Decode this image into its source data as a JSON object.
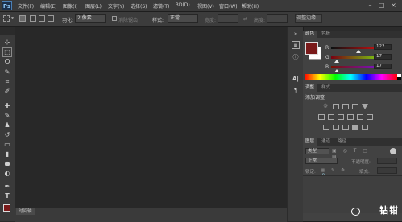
{
  "app": {
    "logo": "Ps"
  },
  "menu": [
    "文件(F)",
    "编辑(E)",
    "图像(I)",
    "图层(L)",
    "文字(Y)",
    "选择(S)",
    "滤镜(T)",
    "3D(D)",
    "视图(V)",
    "窗口(W)",
    "帮助(H)"
  ],
  "window_controls": [
    "–",
    "□",
    "×"
  ],
  "options": {
    "feather_label": "羽化:",
    "feather_value": "2 像素",
    "antialias_label": "消除锯齿",
    "style_label": "样式:",
    "style_value": "正常",
    "width_label": "宽度:",
    "height_label": "高度:",
    "refine_edge_label": "调整边缘..."
  },
  "tools": [
    "move-icon",
    "marquee-icon",
    "lasso-icon",
    "quick-select-icon",
    "crop-icon",
    "eyedropper-icon",
    "healing-icon",
    "brush-icon",
    "stamp-icon",
    "history-brush-icon",
    "eraser-icon",
    "gradient-icon",
    "blur-icon",
    "dodge-icon",
    "pen-icon",
    "type-icon"
  ],
  "tool_glyphs": [
    "⊹",
    "⬚",
    "ⵔ",
    "✎",
    "⌗",
    "✐",
    "✚",
    "✎",
    "♟",
    "↺",
    "▭",
    "▮",
    "●",
    "◐",
    "✒",
    "T"
  ],
  "color_panel": {
    "tabs": [
      "颜色",
      "色板"
    ],
    "fg_color": "#7a1a1a",
    "bg_color": "#ffffff",
    "channels": [
      {
        "label": "R",
        "value": "122"
      },
      {
        "label": "G",
        "value": "17"
      },
      {
        "label": "B",
        "value": "17"
      }
    ]
  },
  "adjustments_panel": {
    "tabs": [
      "调整",
      "样式"
    ],
    "title": "添加调整"
  },
  "layers_panel": {
    "tabs": [
      "图层",
      "通道",
      "路径"
    ],
    "kind_label": "类型",
    "blend_mode": "正常",
    "opacity_label": "不透明度:",
    "lock_label": "锁定:",
    "fill_label": "填充:"
  },
  "timeline": {
    "label": "时间轴"
  },
  "watermark": {
    "text": "钻钳"
  }
}
